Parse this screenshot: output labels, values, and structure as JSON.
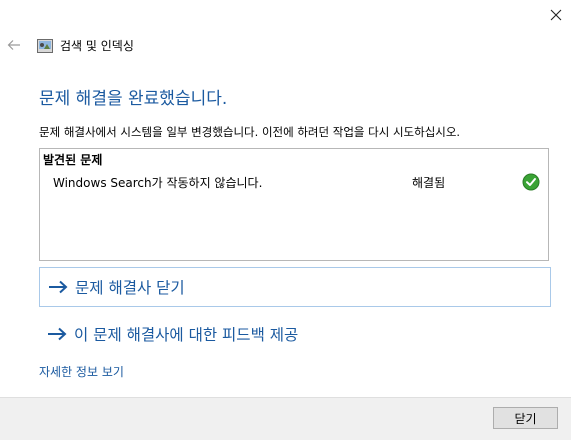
{
  "window": {
    "title": "검색 및 인덱싱",
    "close_glyph": "✕"
  },
  "main": {
    "heading": "문제 해결을 완료했습니다.",
    "description": "문제 해결사에서 시스템을 일부 변경했습니다. 이전에 하려던 작업을 다시 시도하십시오."
  },
  "issues": {
    "header": "발견된 문제",
    "rows": [
      {
        "name": "Windows Search가 작동하지 않습니다.",
        "status": "해결됨",
        "status_icon": "check-icon"
      }
    ]
  },
  "actions": {
    "close_troubleshooter": "문제 해결사 닫기",
    "feedback": "이 문제 해결사에 대한 피드백 제공",
    "view_details": "자세한 정보 보기"
  },
  "footer": {
    "close_button": "닫기"
  },
  "colors": {
    "accent": "#1b5aa0",
    "success": "#3aa335"
  }
}
